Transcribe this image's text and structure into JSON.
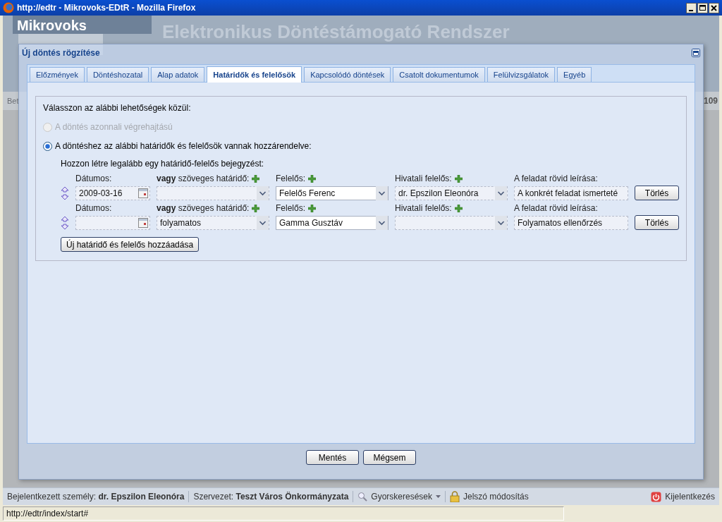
{
  "window": {
    "title": "http://edtr - Mikrovoks-EDtR - Mozilla Firefox"
  },
  "app_header": {
    "logo": "Mikrovoks",
    "subtitle": "Elektronikus Döntéstámogató Rendszer",
    "left_fragment": "Bet",
    "right_fragment": "109"
  },
  "dialog": {
    "title": "Új döntés rögzítése",
    "tabs": [
      {
        "label": "Előzmények",
        "selected": false
      },
      {
        "label": "Döntéshozatal",
        "selected": false
      },
      {
        "label": "Alap adatok",
        "selected": false
      },
      {
        "label": "Határidők és felelősök",
        "selected": true
      },
      {
        "label": "Kapcsolódó döntések",
        "selected": false
      },
      {
        "label": "Csatolt dokumentumok",
        "selected": false
      },
      {
        "label": "Felülvizsgálatok",
        "selected": false
      },
      {
        "label": "Egyéb",
        "selected": false
      }
    ],
    "prompt": "Válasszon az alábbi lehetőségek közül:",
    "options": [
      {
        "label": "A döntés azonnali végrehajtású",
        "selected": false,
        "disabled": true
      },
      {
        "label": "A döntéshez az alábbi határidők és felelősök vannak hozzárendelve:",
        "selected": true,
        "disabled": false
      }
    ],
    "instruction": "Hozzon létre legalább egy határidő-felelős bejegyzést:",
    "entries": [
      {
        "date_label": "Dátumos:",
        "date": "2009-03-16",
        "text_deadline_label": "**vagy** szöveges határidő:",
        "responsible_label": "Felelős:",
        "responsible": "Felelős Ferenc",
        "office_label": "Hivatali felelős:",
        "office": "dr. Epszilon Eleonóra",
        "description_label": "A feladat rövid leírása:",
        "description": "A konkrét feladat ismerteté",
        "delete": "Törlés"
      },
      {
        "date_label": "Dátumos:",
        "text_deadline_label": "**vagy** szöveges határidő:",
        "text_deadline": "folyamatos",
        "responsible_label": "Felelős:",
        "responsible": "Gamma Gusztáv",
        "office_label": "Hivatali felelős:",
        "description_label": "A feladat rövid leírása:",
        "description": "Folyamatos ellenőrzés",
        "delete": "Törlés"
      }
    ],
    "add_button": "Új határidő és felelős hozzáadása",
    "buttons": [
      "Mentés",
      "Mégsem"
    ]
  },
  "status_bar": {
    "user": "Bejelentkezett személy: **dr. Epszilon Eleonóra**",
    "organization": "Szervezet: **Teszt Város Önkormányzata**",
    "quick_search": "Gyorskeresések",
    "password": "Jelszó módosítás",
    "logout": "Kijelentkezés"
  },
  "browser_status": "http://edtr/index/start#"
}
